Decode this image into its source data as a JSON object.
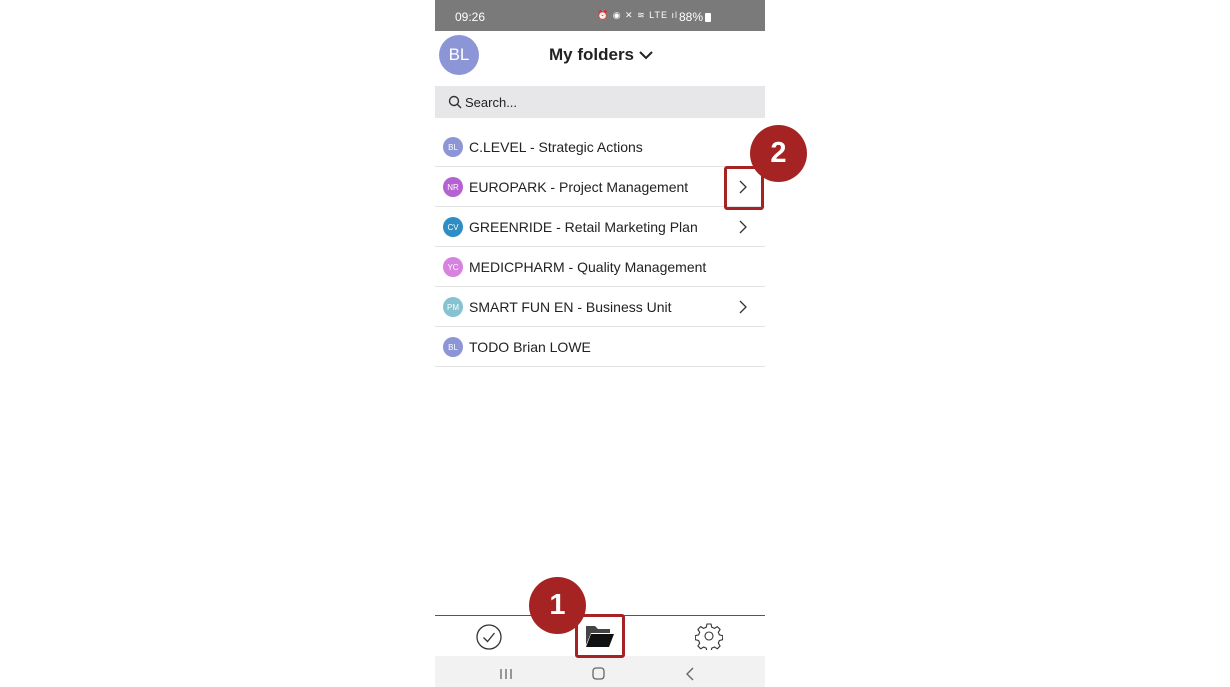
{
  "status_bar": {
    "time": "09:26",
    "icons": "⏰ ◉ ✕ ≋ LTE ıl",
    "battery": "88%"
  },
  "header": {
    "avatar_initials": "BL",
    "title": "My folders"
  },
  "search": {
    "placeholder": "Search..."
  },
  "folders": [
    {
      "initials": "BL",
      "label": "C.LEVEL - Strategic Actions",
      "color": "#8c95d6",
      "has_children": false
    },
    {
      "initials": "NR",
      "label": "EUROPARK - Project Management",
      "color": "#b661d1",
      "has_children": true
    },
    {
      "initials": "CV",
      "label": "GREENRIDE - Retail Marketing Plan",
      "color": "#2f8dc5",
      "has_children": true
    },
    {
      "initials": "YC",
      "label": "MEDICPHARM - Quality Management",
      "color": "#d782e0",
      "has_children": false
    },
    {
      "initials": "PM",
      "label": "SMART FUN EN - Business Unit",
      "color": "#85c3d1",
      "has_children": true
    },
    {
      "initials": "BL",
      "label": "TODO Brian LOWE",
      "color": "#8c95d6",
      "has_children": false
    }
  ],
  "bottom_nav": {
    "items": [
      "check-circle-icon",
      "folder-open-icon",
      "gear-icon"
    ],
    "active": "folder-open-icon"
  },
  "callouts": [
    {
      "number": "1"
    },
    {
      "number": "2"
    }
  ],
  "colors": {
    "callout": "#a52323",
    "status_bar": "#7a7a7a",
    "search_bg": "#e7e7e9"
  }
}
